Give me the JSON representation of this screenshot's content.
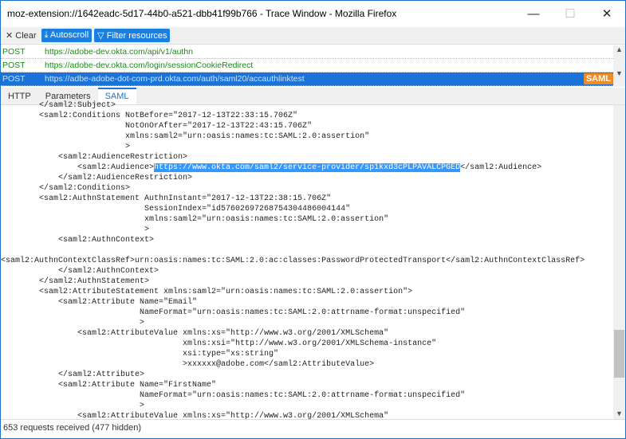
{
  "window": {
    "title": "moz-extension://1642eadc-5d17-44b0-a521-dbb41f99b766 - Trace Window - Mozilla Firefox",
    "minimize": "—",
    "maximize": "☐",
    "close": "✕"
  },
  "toolbar": {
    "clear": "✕ Clear",
    "autoscroll": "⤓ Autoscroll",
    "filter": "▽ Filter resources"
  },
  "requests": [
    {
      "method": "POST",
      "url": "https://adobe-dev.okta.com/api/v1/authn"
    },
    {
      "method": "POST",
      "url": "https://adobe-dev.okta.com/login/sessionCookieRedirect"
    },
    {
      "method": "POST",
      "url": "https://adbe-adobe-dot-com-prd.okta.com/auth/saml20/accauthlinktest",
      "badge": "SAML"
    }
  ],
  "tabs": [
    "HTTP",
    "Parameters",
    "SAML"
  ],
  "code": [
    {
      "t": "        </saml2:Subject>"
    },
    {
      "t": "        <saml2:Conditions NotBefore=\"2017-12-13T22:33:15.706Z\""
    },
    {
      "t": "                          NotOnOrAfter=\"2017-12-13T22:43:15.706Z\""
    },
    {
      "t": "                          xmlns:saml2=\"urn:oasis:names:tc:SAML:2.0:assertion\""
    },
    {
      "t": "                          >"
    },
    {
      "t": "            <saml2:AudienceRestriction>"
    },
    {
      "t": "                <saml2:Audience>",
      "hl": "https://www.okta.com/saml2/service-provider/sp1kxd3cPLPAVALCPGED",
      "post": "</saml2:Audience>"
    },
    {
      "t": "            </saml2:AudienceRestriction>"
    },
    {
      "t": "        </saml2:Conditions>"
    },
    {
      "t": "        <saml2:AuthnStatement AuthnInstant=\"2017-12-13T22:38:15.706Z\""
    },
    {
      "t": "                              SessionIndex=\"id57602697268754304486004144\""
    },
    {
      "t": "                              xmlns:saml2=\"urn:oasis:names:tc:SAML:2.0:assertion\""
    },
    {
      "t": "                              >"
    },
    {
      "t": "            <saml2:AuthnContext>"
    },
    {
      "t": ""
    },
    {
      "t": "<saml2:AuthnContextClassRef>urn:oasis:names:tc:SAML:2.0:ac:classes:PasswordProtectedTransport</saml2:AuthnContextClassRef>"
    },
    {
      "t": "            </saml2:AuthnContext>"
    },
    {
      "t": "        </saml2:AuthnStatement>"
    },
    {
      "t": "        <saml2:AttributeStatement xmlns:saml2=\"urn:oasis:names:tc:SAML:2.0:assertion\">"
    },
    {
      "t": "            <saml2:Attribute Name=\"Email\""
    },
    {
      "t": "                             NameFormat=\"urn:oasis:names:tc:SAML:2.0:attrname-format:unspecified\""
    },
    {
      "t": "                             >"
    },
    {
      "t": "                <saml2:AttributeValue xmlns:xs=\"http://www.w3.org/2001/XMLSchema\""
    },
    {
      "t": "                                      xmlns:xsi=\"http://www.w3.org/2001/XMLSchema-instance\""
    },
    {
      "t": "                                      xsi:type=\"xs:string\""
    },
    {
      "t": "                                      >xxxxxx@adobe.com</saml2:AttributeValue>"
    },
    {
      "t": "            </saml2:Attribute>"
    },
    {
      "t": "            <saml2:Attribute Name=\"FirstName\""
    },
    {
      "t": "                             NameFormat=\"urn:oasis:names:tc:SAML:2.0:attrname-format:unspecified\""
    },
    {
      "t": "                             >"
    },
    {
      "t": "                <saml2:AttributeValue xmlns:xs=\"http://www.w3.org/2001/XMLSchema\""
    }
  ],
  "status": "653 requests received (477 hidden)"
}
